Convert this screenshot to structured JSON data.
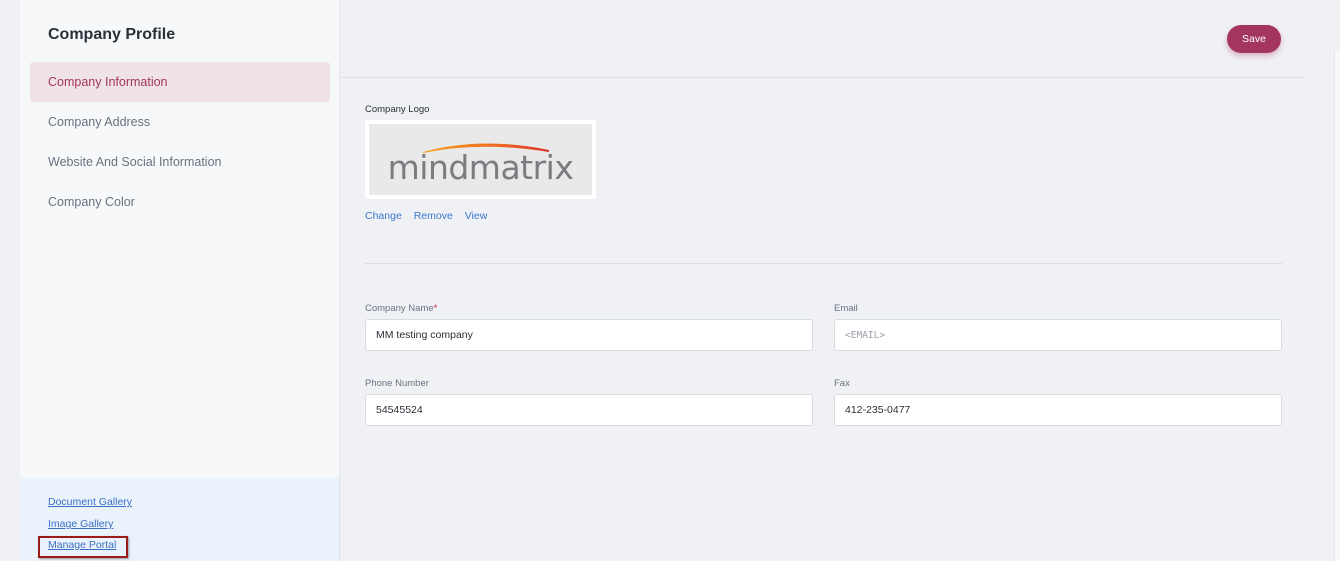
{
  "sidebar": {
    "title": "Company Profile",
    "items": [
      {
        "label": "Company Information"
      },
      {
        "label": "Company Address"
      },
      {
        "label": "Website And Social Information"
      },
      {
        "label": "Company Color"
      }
    ],
    "bottom_links": [
      {
        "label": "Document Gallery"
      },
      {
        "label": "Image Gallery"
      },
      {
        "label": "Manage Portal"
      }
    ]
  },
  "header": {
    "save_label": "Save"
  },
  "logo": {
    "label": "Company Logo",
    "wordmark": "mindmatrix",
    "actions": {
      "change": "Change",
      "remove": "Remove",
      "view": "View"
    }
  },
  "form": {
    "company_name": {
      "label": "Company Name",
      "required_mark": "*",
      "value": "MM testing company"
    },
    "email": {
      "label": "Email",
      "placeholder": "<EMAIL>",
      "value": ""
    },
    "phone": {
      "label": "Phone Number",
      "value": "54545524"
    },
    "fax": {
      "label": "Fax",
      "value": "412-235-0477"
    }
  },
  "colors": {
    "accent": "#a3355f",
    "link": "#3b78cf",
    "active_nav_bg": "#f0e3e8"
  }
}
